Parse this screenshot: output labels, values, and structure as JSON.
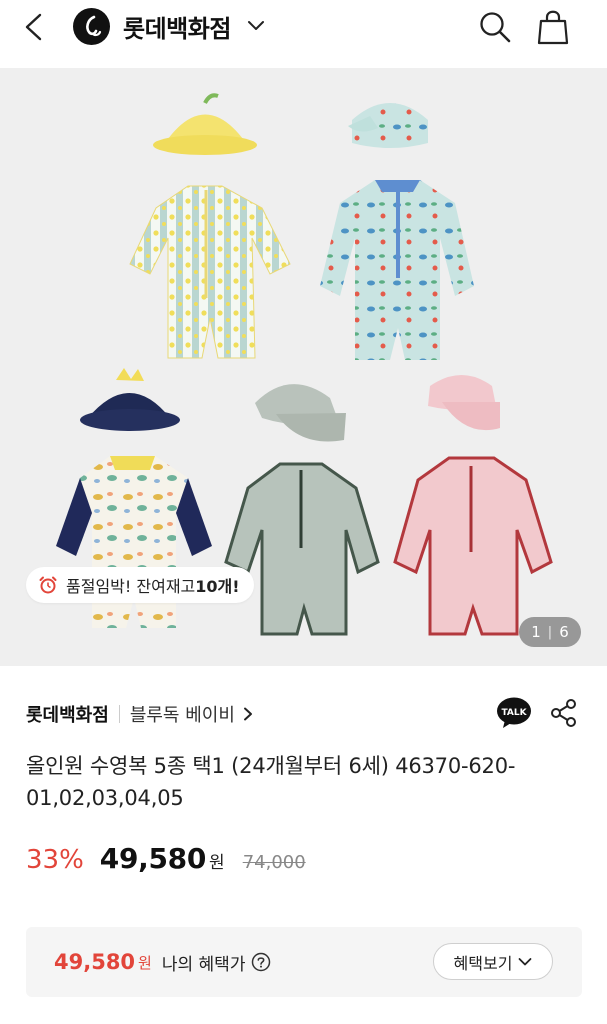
{
  "header": {
    "brand_name": "롯데백화점",
    "icons": [
      "back-icon",
      "brand-logo-icon",
      "chevron-down-icon",
      "search-icon",
      "shopping-bag-icon"
    ]
  },
  "gallery": {
    "stock_text": "품절임박! 잔여재고 ",
    "stock_count": "10개!",
    "current_page": "1",
    "total_pages": "6"
  },
  "store": {
    "name": "롯데백화점",
    "brand": "블루독 베이비",
    "talk_label": "TALK"
  },
  "product": {
    "title": "올인원 수영복 5종 택1 (24개월부터 6세) 46370-620-01,02,03,04,05",
    "discount": "33%",
    "price": "49,580",
    "won": "원",
    "original_price": "74,000"
  },
  "benefit": {
    "price": "49,580",
    "won": "원",
    "label": "나의 혜택가",
    "button": "혜택보기"
  },
  "colors": {
    "accent_red": "#e2453a",
    "gallery_bg": "#efefef",
    "benefit_bg": "#f5f5f5"
  }
}
